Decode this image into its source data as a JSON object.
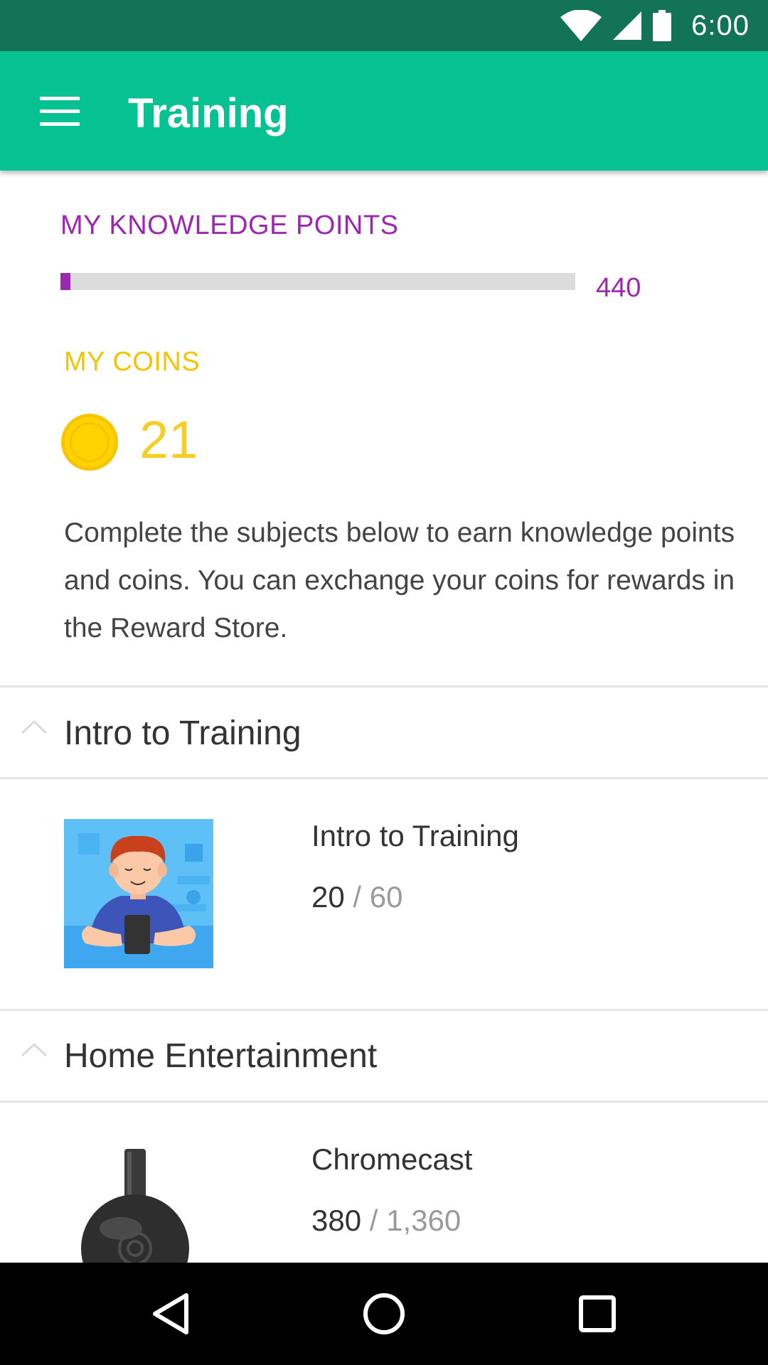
{
  "status_bar": {
    "time": "6:00",
    "icons": [
      "wifi-icon",
      "signal-icon",
      "battery-icon"
    ]
  },
  "app_bar": {
    "title": "Training",
    "menu_icon": "hamburger-menu-icon"
  },
  "knowledge_points": {
    "label": "MY KNOWLEDGE POINTS",
    "value": "440",
    "progress_fraction": 0.02
  },
  "coins": {
    "label": "MY COINS",
    "value": "21",
    "icon": "coin-icon"
  },
  "description": "Complete the subjects below to earn knowledge points and coins. You can exchange your coins for rewards in the Reward Store.",
  "sections": [
    {
      "title": "Intro to Training",
      "expanded": true,
      "items": [
        {
          "name": "Intro to Training",
          "completed": "20",
          "separator": "/",
          "total": "60",
          "thumbnail": "person-with-phone-illustration"
        }
      ]
    },
    {
      "title": "Home Entertainment",
      "expanded": true,
      "items": [
        {
          "name": "Chromecast",
          "completed": "380",
          "separator": "/",
          "total": "1,360",
          "thumbnail": "chromecast-device-image"
        }
      ]
    }
  ],
  "nav_bar": {
    "buttons": [
      "back-icon",
      "home-icon",
      "recents-icon"
    ]
  },
  "colors": {
    "status_bar": "#137356",
    "app_bar": "#06c293",
    "knowledge_accent": "#9c27b0",
    "coins_accent": "#f5cf25",
    "nav_bar": "#000000"
  }
}
